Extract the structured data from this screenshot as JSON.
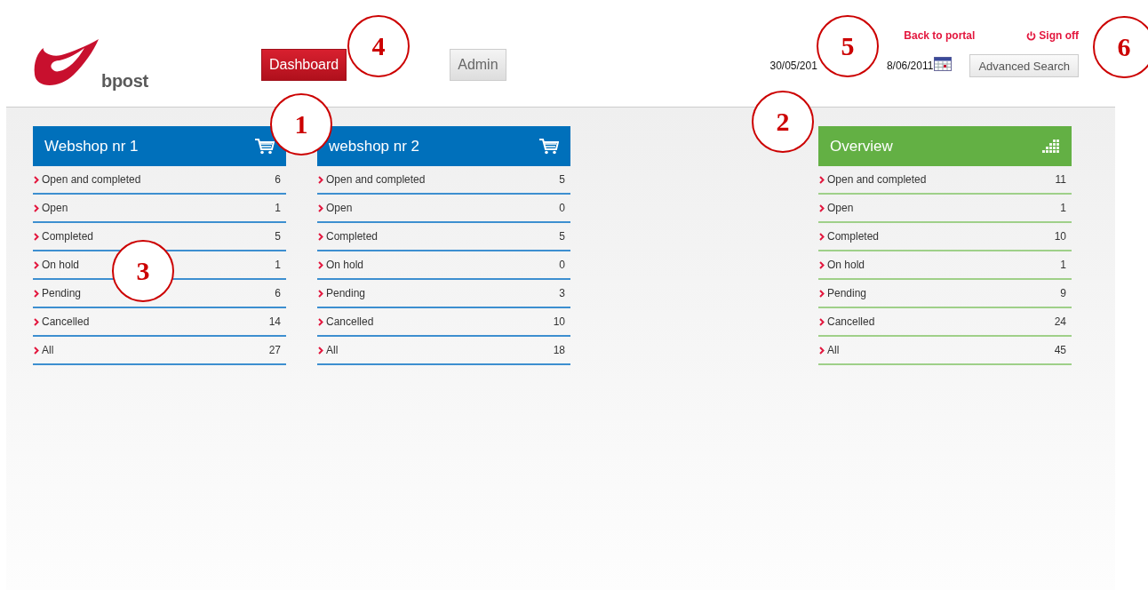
{
  "logo": {
    "text": "bpost"
  },
  "nav_tabs": [
    {
      "label": "Dashboard",
      "selected": true
    },
    {
      "label": "Admin",
      "selected": false
    }
  ],
  "top_links": [
    {
      "kind": "link",
      "label": "Back to portal"
    },
    {
      "kind": "signoff",
      "label": "Sign off"
    }
  ],
  "date_range": {
    "from": "30/05/201",
    "to": "8/06/2011"
  },
  "advanced_search_button": "Advanced Search",
  "panels": [
    {
      "kind": "webshop",
      "title": "Webshop nr 1",
      "rows": [
        {
          "label": "Open and completed",
          "count": "6"
        },
        {
          "label": "Open",
          "count": "1"
        },
        {
          "label": "Completed",
          "count": "5"
        },
        {
          "label": "On hold",
          "count": "1"
        },
        {
          "label": "Pending",
          "count": "6"
        },
        {
          "label": "Cancelled",
          "count": "14"
        },
        {
          "label": "All",
          "count": "27"
        }
      ]
    },
    {
      "kind": "webshop",
      "title": "webshop nr 2",
      "rows": [
        {
          "label": "Open and completed",
          "count": "5"
        },
        {
          "label": "Open",
          "count": "0"
        },
        {
          "label": "Completed",
          "count": "5"
        },
        {
          "label": "On hold",
          "count": "0"
        },
        {
          "label": "Pending",
          "count": "3"
        },
        {
          "label": "Cancelled",
          "count": "10"
        },
        {
          "label": "All",
          "count": "18"
        }
      ]
    },
    {
      "kind": "overview",
      "title": "Overview",
      "rows": [
        {
          "label": "Open and completed",
          "count": "11"
        },
        {
          "label": "Open",
          "count": "1"
        },
        {
          "label": "Completed",
          "count": "10"
        },
        {
          "label": "On hold",
          "count": "1"
        },
        {
          "label": "Pending",
          "count": "9"
        },
        {
          "label": "Cancelled",
          "count": "24"
        },
        {
          "label": "All",
          "count": "45"
        }
      ]
    }
  ],
  "callouts": [
    "1",
    "2",
    "3",
    "4",
    "5",
    "6"
  ]
}
